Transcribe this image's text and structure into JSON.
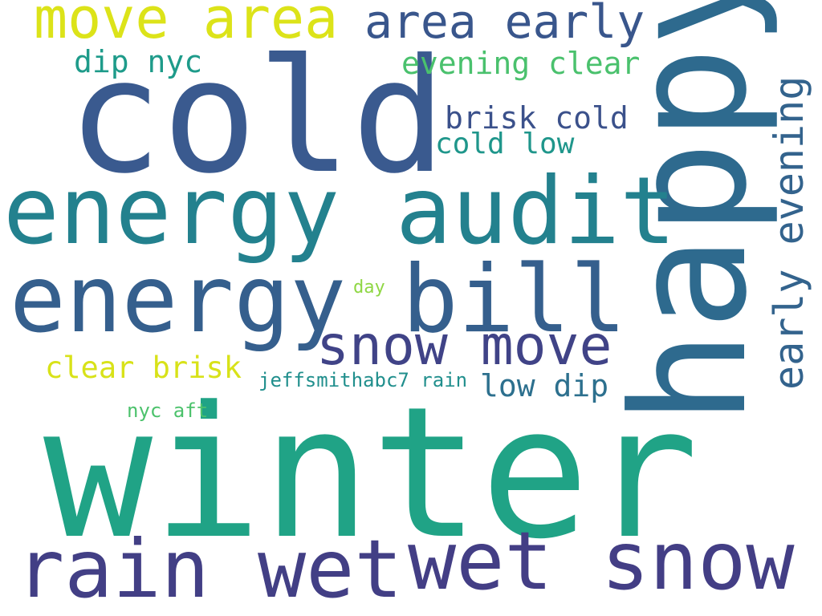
{
  "words": {
    "winter": {
      "text": "winter",
      "color": "#20a386"
    },
    "cold": {
      "text": "cold",
      "color": "#3a5a8f"
    },
    "happy": {
      "text": "happy",
      "color": "#2e6a8e"
    },
    "energy_audit": {
      "text": "energy audit",
      "color": "#23818e"
    },
    "energy_bill": {
      "text": "energy bill",
      "color": "#355f8d"
    },
    "rain_wet": {
      "text": "rain wet",
      "color": "#423f85"
    },
    "wet_snow": {
      "text": "wet snow",
      "color": "#433e85"
    },
    "move_area": {
      "text": "move area",
      "color": "#dce319"
    },
    "area_early": {
      "text": "area early",
      "color": "#39568c"
    },
    "snow_move": {
      "text": "snow move",
      "color": "#404387"
    },
    "early_evening": {
      "text": "early evening",
      "color": "#33638d"
    },
    "evening_clear": {
      "text": "evening clear",
      "color": "#4ac16d"
    },
    "dip_nyc": {
      "text": "dip nyc",
      "color": "#1e9b8a"
    },
    "brisk_cold": {
      "text": "brisk cold",
      "color": "#3b518b"
    },
    "cold_low": {
      "text": "cold low",
      "color": "#1f968b"
    },
    "clear_brisk": {
      "text": "clear brisk",
      "color": "#d8e219"
    },
    "low_dip": {
      "text": "low dip",
      "color": "#2d708e"
    },
    "jeffsmithabc7_rain": {
      "text": "jeffsmithabc7 rain",
      "color": "#218f8d"
    },
    "nyc_aft": {
      "text": "nyc aft",
      "color": "#4cc26c"
    },
    "day": {
      "text": "day",
      "color": "#8fd744"
    }
  }
}
